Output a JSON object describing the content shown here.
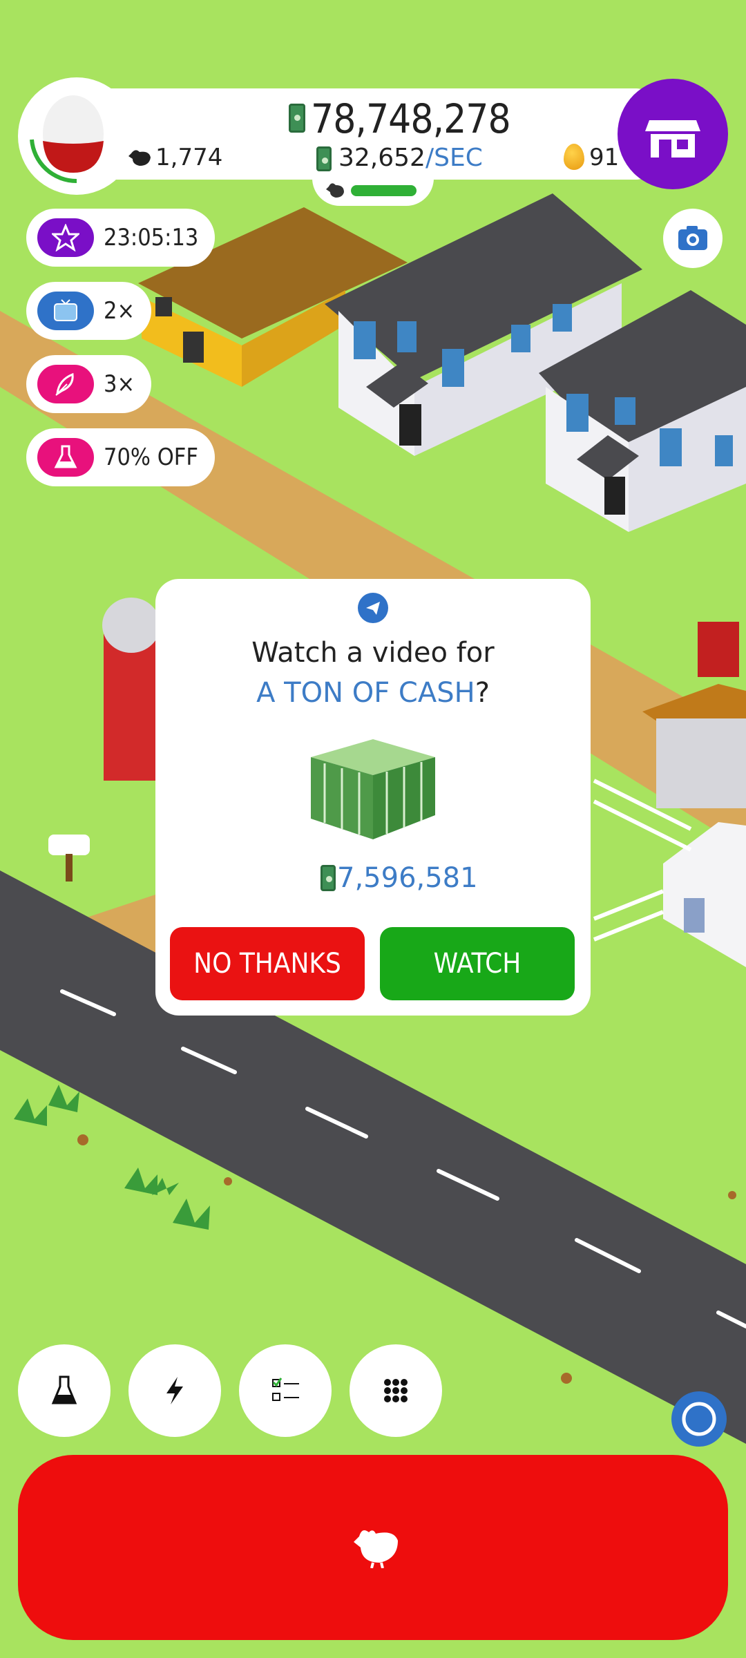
{
  "hud": {
    "cash": "78,748,278",
    "chicken_count": "1,774",
    "income_rate": "32,652",
    "income_unit": "/SEC",
    "golden_eggs": "91"
  },
  "boosts": [
    {
      "label": "23:05:13",
      "icon": "star-icon",
      "color": "#7a0fc7"
    },
    {
      "label": "2×",
      "icon": "tv-icon",
      "color": "#2f72c8"
    },
    {
      "label": "3×",
      "icon": "feather-icon",
      "color": "#e8117c"
    },
    {
      "label": "70% OFF",
      "icon": "flask-icon",
      "color": "#e8117c"
    }
  ],
  "modal": {
    "title": "Watch a video for",
    "subtitle": "A TON OF CASH",
    "subtitle_suffix": "?",
    "reward": "7,596,581",
    "decline_label": "NO THANKS",
    "accept_label": "WATCH"
  },
  "toolbar": [
    "flask-icon",
    "lightning-icon",
    "checklist-icon",
    "grid-icon"
  ],
  "colors": {
    "grass": "#a8e35f",
    "accent_purple": "#7a0fc7",
    "accent_blue": "#3d7cc6",
    "decline_red": "#ea1212",
    "accept_green": "#18a818",
    "hatch_red": "#ee0d0d"
  }
}
